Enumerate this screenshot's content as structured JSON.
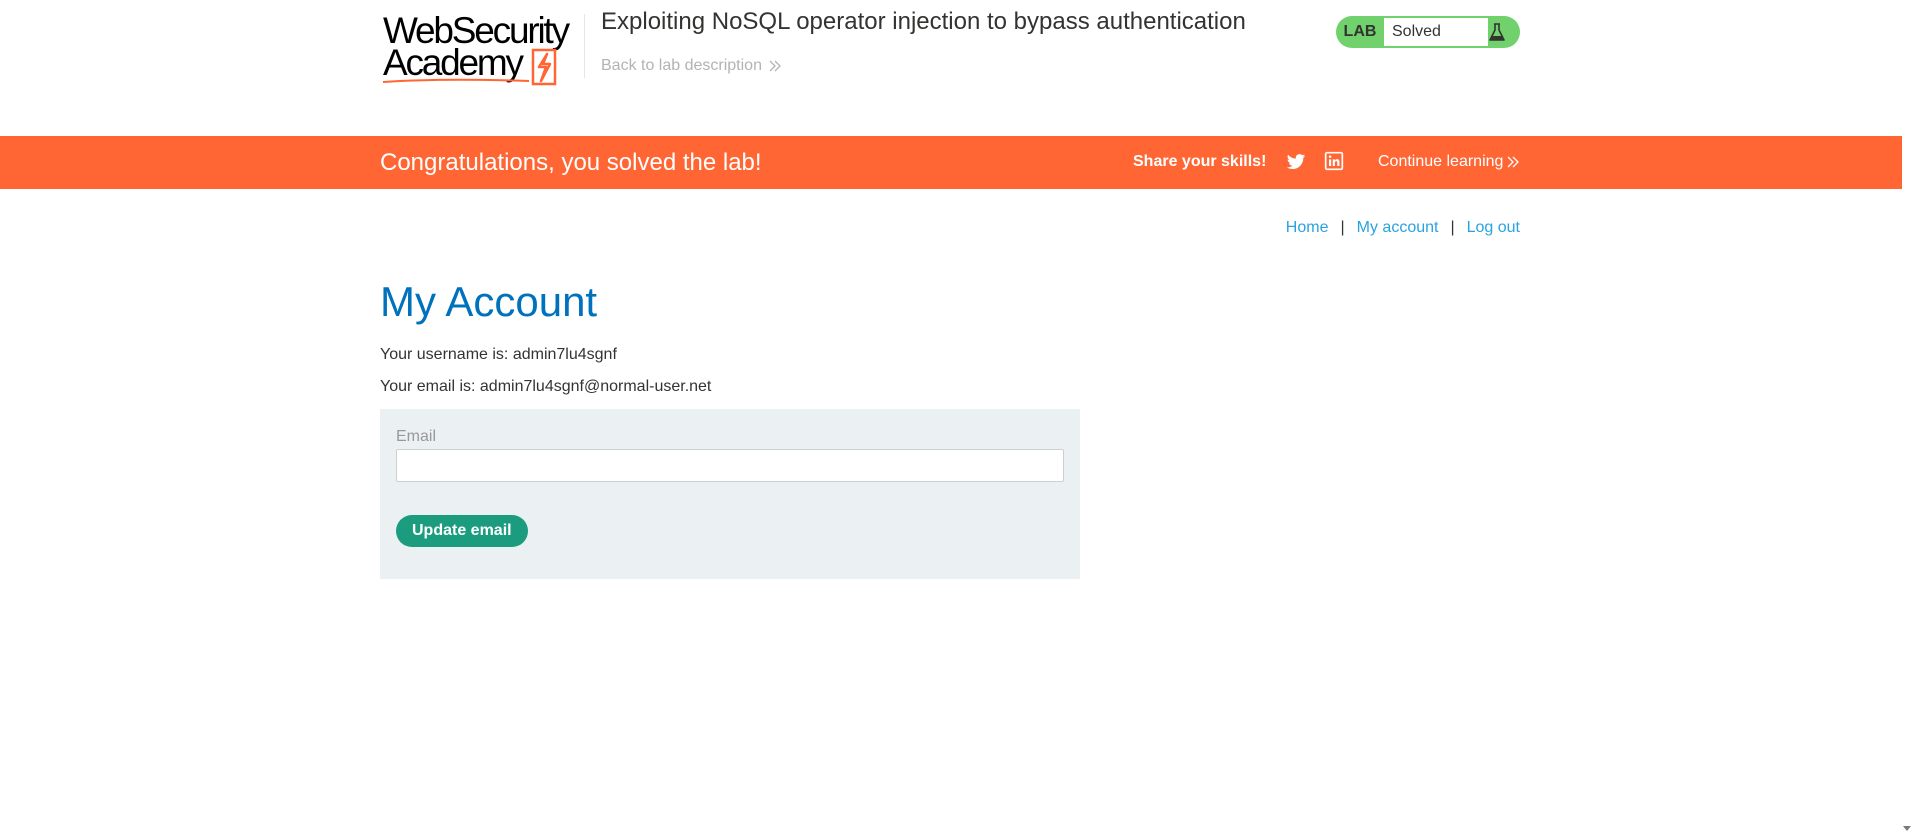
{
  "header": {
    "logo": {
      "line1": "WebSecurity",
      "line2": "Academy"
    },
    "lab_title": "Exploiting NoSQL operator injection to bypass authentication",
    "back_link": "Back to lab description",
    "status": {
      "tag": "LAB",
      "value": "Solved",
      "icon": "flask-icon"
    }
  },
  "banner": {
    "message": "Congratulations, you solved the lab!",
    "share_label": "Share your skills!",
    "share_icons": [
      "twitter-icon",
      "linkedin-icon"
    ],
    "continue_link": "Continue learning"
  },
  "nav": {
    "links": [
      "Home",
      "My account",
      "Log out"
    ],
    "separator": "|"
  },
  "account": {
    "title": "My Account",
    "username_line": "Your username is: admin7lu4sgnf",
    "email_line": "Your email is: admin7lu4sgnf@normal-user.net"
  },
  "form": {
    "email_label": "Email",
    "email_value": "",
    "submit_label": "Update email"
  },
  "colors": {
    "banner": "#ff6633",
    "status_green": "#70d16d",
    "link": "#29a3e0",
    "title": "#0071bc",
    "button": "#1b9c7f",
    "panel": "#ebf0f2"
  }
}
